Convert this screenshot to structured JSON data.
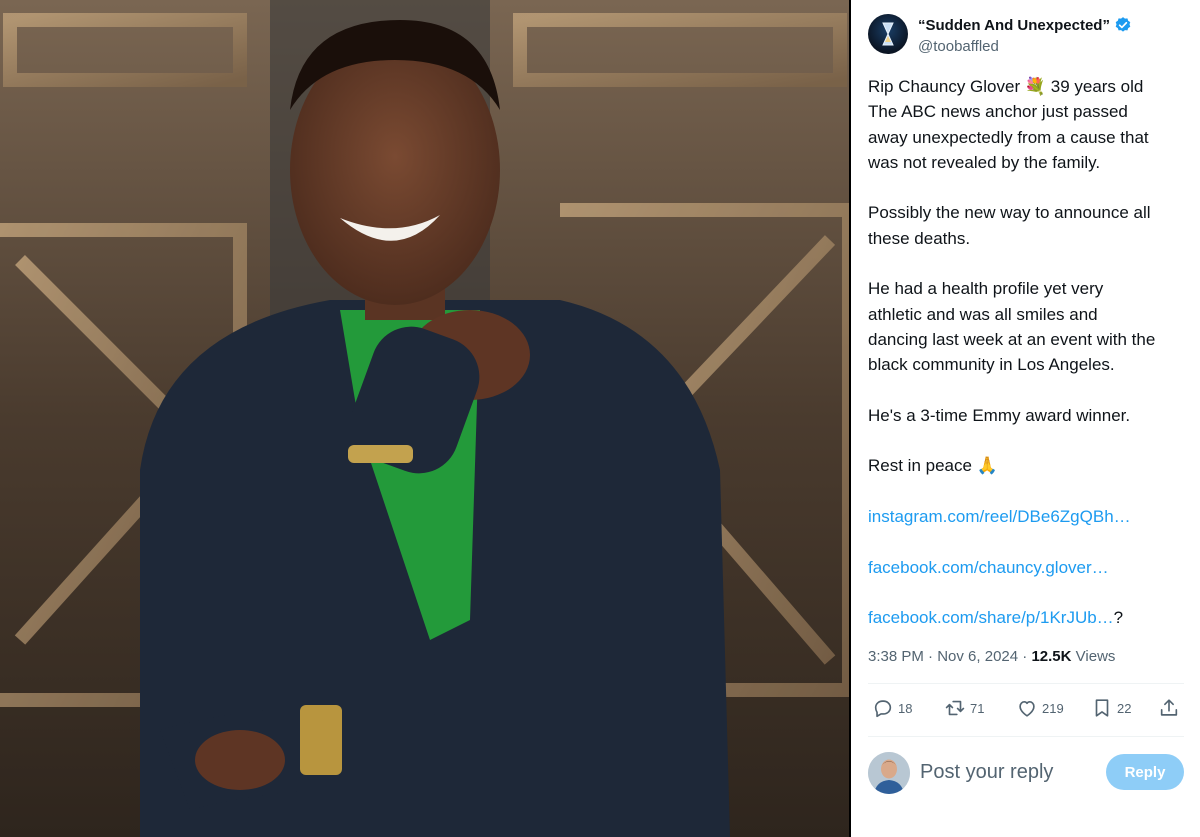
{
  "tweet": {
    "author": {
      "display_name": "“Sudden And Unexpected”",
      "handle": "@toobaffled",
      "verified": true
    },
    "paragraphs": [
      [
        "Rip Chauncy Glover 💐 39 years old",
        "The ABC news anchor just passed",
        "away unexpectedly from a cause that",
        "was not revealed by the family."
      ],
      [
        "Possibly the new way to announce all",
        "these deaths."
      ],
      [
        "He had a health profile yet very",
        "athletic and was all smiles and",
        "dancing last week at an event with the",
        "black community in Los Angeles."
      ],
      [
        "He's a 3-time Emmy award winner."
      ],
      [
        "Rest in peace 🙏"
      ]
    ],
    "links": [
      {
        "text": "instagram.com/reel/DBe6ZgQBh…",
        "suffix": ""
      },
      {
        "text": "facebook.com/chauncy.glover…",
        "suffix": ""
      },
      {
        "text": "facebook.com/share/p/1KrJUb…",
        "suffix": "?"
      }
    ],
    "time": "3:38 PM",
    "date": "Nov 6, 2024",
    "views_count": "12.5K",
    "views_label": "Views"
  },
  "actions": {
    "replies": "18",
    "reposts": "71",
    "likes": "219",
    "bookmarks": "22"
  },
  "reply_box": {
    "placeholder": "Post your reply",
    "button_label": "Reply"
  },
  "colors": {
    "link": "#1d9bf0",
    "muted_text": "#536471",
    "reply_button_disabled": "#8ecdf7"
  },
  "icons": [
    "hourglass-icon",
    "verified-badge-icon",
    "reply-icon",
    "repost-icon",
    "like-icon",
    "bookmark-icon",
    "share-icon"
  ]
}
